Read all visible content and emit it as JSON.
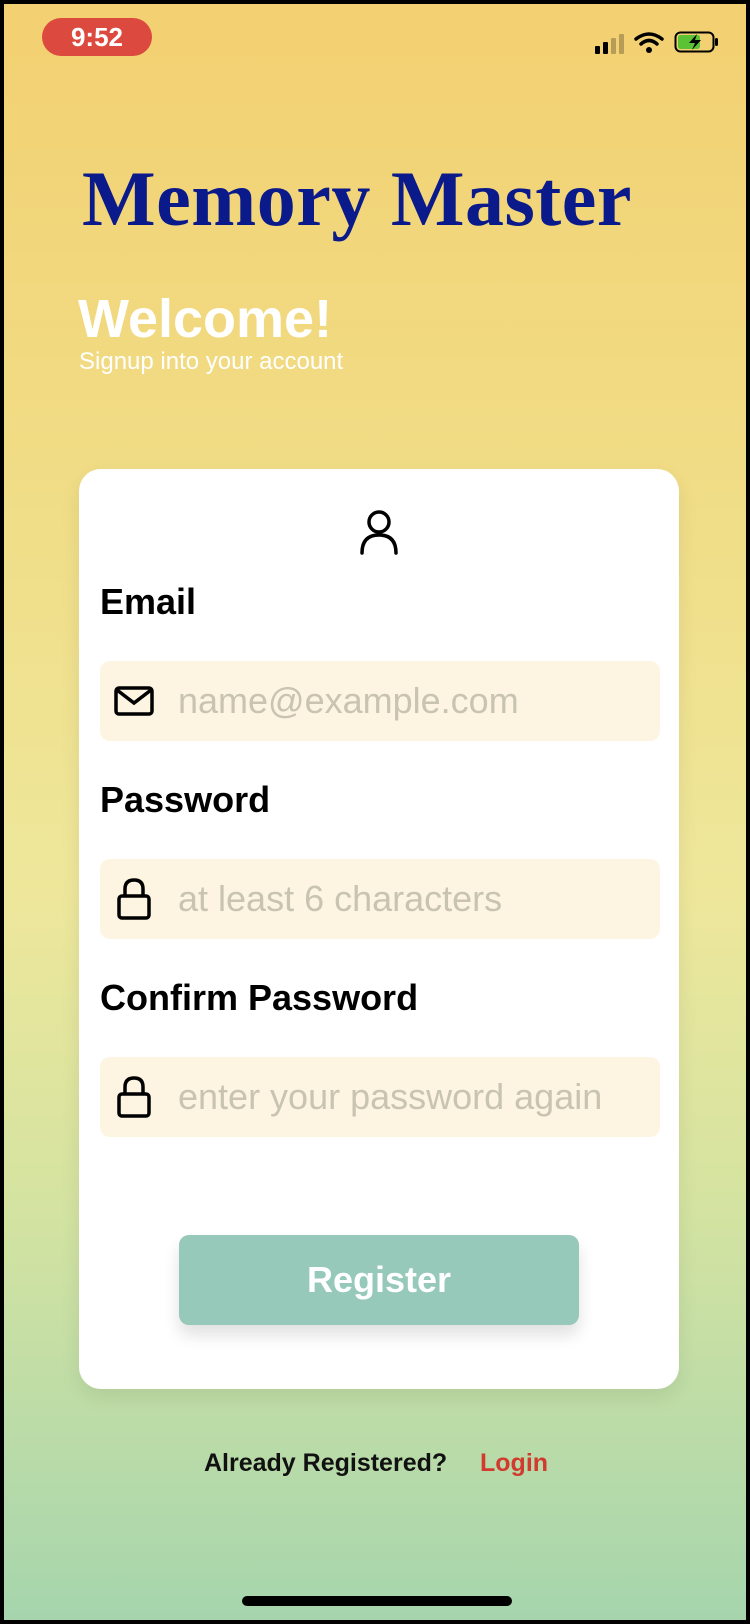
{
  "status_bar": {
    "time": "9:52"
  },
  "app_title": "Memory Master",
  "welcome": "Welcome!",
  "subtitle": "Signup into your account",
  "form": {
    "email": {
      "label": "Email",
      "placeholder": "name@example.com",
      "value": ""
    },
    "password": {
      "label": "Password",
      "placeholder": "at least 6 characters",
      "value": ""
    },
    "confirm_password": {
      "label": "Confirm Password",
      "placeholder": "enter your password again",
      "value": ""
    },
    "register_label": "Register"
  },
  "footer": {
    "already_text": "Already Registered?",
    "login_label": "Login"
  },
  "colors": {
    "title": "#0a1a8a",
    "register_button": "#96c9b9",
    "login_link": "#d23a2f",
    "time_pill": "#dc4a3f",
    "input_bg": "#fdf5e1"
  },
  "icons": [
    "user-icon",
    "mail-icon",
    "lock-icon",
    "wifi-icon",
    "battery-charging-icon",
    "signal-icon"
  ]
}
